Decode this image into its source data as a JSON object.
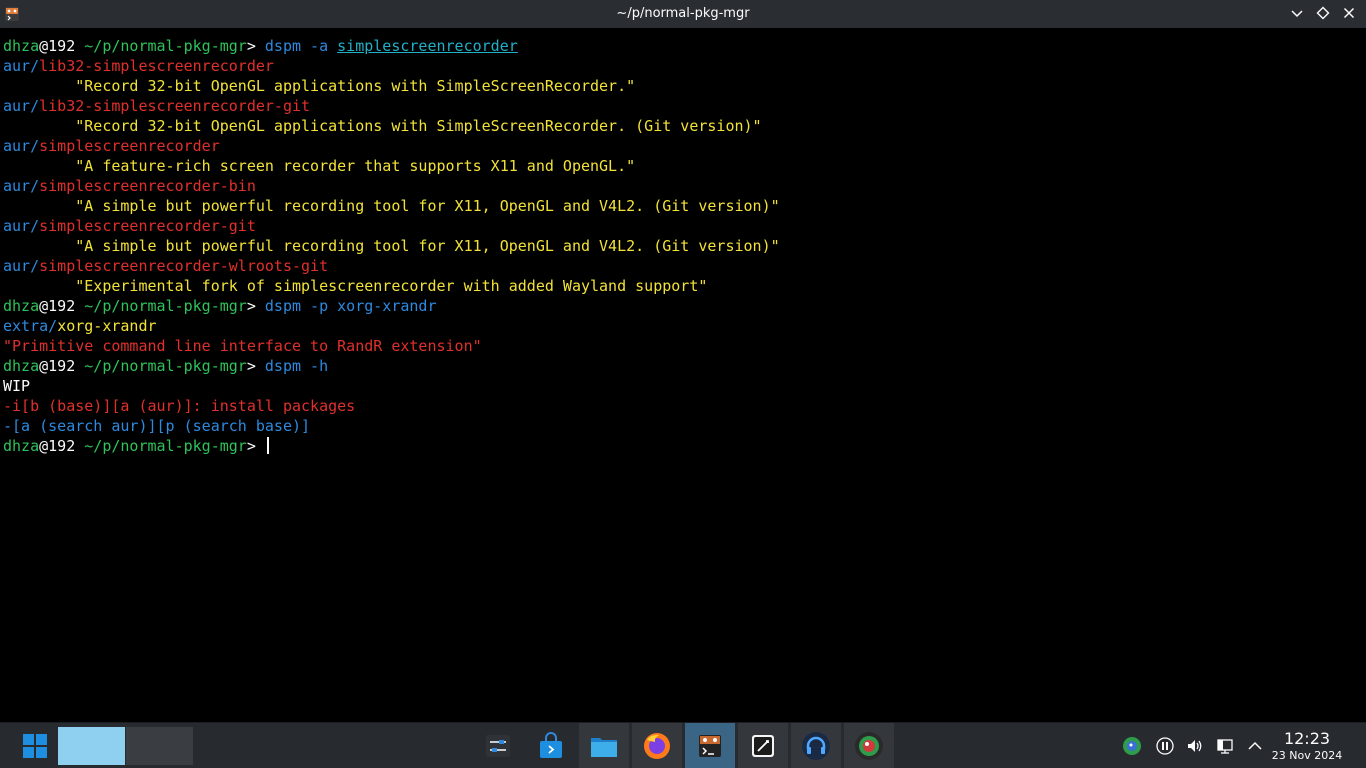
{
  "window": {
    "title": "~/p/normal-pkg-mgr",
    "controls": [
      "chevron-down-icon",
      "diamond-icon",
      "close-icon"
    ]
  },
  "terminal": {
    "lines": [
      [
        {
          "t": "dhza",
          "c": "green"
        },
        {
          "t": "@192 ",
          "c": "white"
        },
        {
          "t": "~/p/normal-pkg-mgr",
          "c": "green"
        },
        {
          "t": "> ",
          "c": "white"
        },
        {
          "t": "dspm",
          "c": "blue"
        },
        {
          "t": " -a ",
          "c": "blue"
        },
        {
          "t": "simplescreenrecorder",
          "c": "cyan",
          "u": true
        }
      ],
      [
        {
          "t": "aur/",
          "c": "blue"
        },
        {
          "t": "lib32-simplescreenrecorder",
          "c": "red"
        }
      ],
      [
        {
          "t": "        \"Record 32-bit OpenGL applications with SimpleScreenRecorder.\"",
          "c": "yellow"
        }
      ],
      [
        {
          "t": "aur/",
          "c": "blue"
        },
        {
          "t": "lib32-simplescreenrecorder-git",
          "c": "red"
        }
      ],
      [
        {
          "t": "        \"Record 32-bit OpenGL applications with SimpleScreenRecorder. (Git version)\"",
          "c": "yellow"
        }
      ],
      [
        {
          "t": "aur/",
          "c": "blue"
        },
        {
          "t": "simplescreenrecorder",
          "c": "red"
        }
      ],
      [
        {
          "t": "        \"A feature-rich screen recorder that supports X11 and OpenGL.\"",
          "c": "yellow"
        }
      ],
      [
        {
          "t": "aur/",
          "c": "blue"
        },
        {
          "t": "simplescreenrecorder-bin",
          "c": "red"
        }
      ],
      [
        {
          "t": "        \"A simple but powerful recording tool for X11, OpenGL and V4L2. (Git version)\"",
          "c": "yellow"
        }
      ],
      [
        {
          "t": "aur/",
          "c": "blue"
        },
        {
          "t": "simplescreenrecorder-git",
          "c": "red"
        }
      ],
      [
        {
          "t": "        \"A simple but powerful recording tool for X11, OpenGL and V4L2. (Git version)\"",
          "c": "yellow"
        }
      ],
      [
        {
          "t": "aur/",
          "c": "blue"
        },
        {
          "t": "simplescreenrecorder-wlroots-git",
          "c": "red"
        }
      ],
      [
        {
          "t": "        \"Experimental fork of simplescreenrecorder with added Wayland support\"",
          "c": "yellow"
        }
      ],
      [
        {
          "t": "dhza",
          "c": "green"
        },
        {
          "t": "@192 ",
          "c": "white"
        },
        {
          "t": "~/p/normal-pkg-mgr",
          "c": "green"
        },
        {
          "t": "> ",
          "c": "white"
        },
        {
          "t": "dspm",
          "c": "blue"
        },
        {
          "t": " -p xorg-xrandr",
          "c": "blue"
        }
      ],
      [
        {
          "t": "extra/",
          "c": "blue"
        },
        {
          "t": "xorg-xrandr",
          "c": "yellow"
        }
      ],
      [
        {
          "t": "\"Primitive command line interface to RandR extension\"",
          "c": "red"
        }
      ],
      [
        {
          "t": "dhza",
          "c": "green"
        },
        {
          "t": "@192 ",
          "c": "white"
        },
        {
          "t": "~/p/normal-pkg-mgr",
          "c": "green"
        },
        {
          "t": "> ",
          "c": "white"
        },
        {
          "t": "dspm",
          "c": "blue"
        },
        {
          "t": " -h",
          "c": "blue"
        }
      ],
      [
        {
          "t": "WIP",
          "c": "white"
        }
      ],
      [
        {
          "t": "-i[b (base)][a (aur)]: install packages",
          "c": "red"
        }
      ],
      [
        {
          "t": "-[a (search aur)][p (search base)]",
          "c": "blue"
        }
      ],
      [
        {
          "t": "dhza",
          "c": "green"
        },
        {
          "t": "@192 ",
          "c": "white"
        },
        {
          "t": "~/p/normal-pkg-mgr",
          "c": "green"
        },
        {
          "t": "> ",
          "c": "white"
        }
      ]
    ]
  },
  "taskbar": {
    "start_icon": "windows-start-icon",
    "tasks": [
      {
        "name": "system-settings-icon"
      },
      {
        "name": "software-store-icon"
      },
      {
        "name": "file-manager-icon"
      },
      {
        "name": "firefox-icon"
      },
      {
        "name": "terminal-icon"
      },
      {
        "name": "text-editor-icon"
      },
      {
        "name": "headphones-app-icon"
      },
      {
        "name": "lens-app-icon"
      }
    ],
    "tray": [
      "network-globe-icon",
      "media-pause-icon",
      "volume-icon",
      "display-icon",
      "chevron-up-icon"
    ],
    "clock": {
      "time": "12:23",
      "date": "23 Nov 2024"
    }
  },
  "colors": {
    "green": "#2ec25a",
    "white": "#fcfcfc",
    "blue": "#2d8ae0",
    "cyan": "#20b0c8",
    "red": "#e0302c",
    "yellow": "#f2e238",
    "taskbar_bg": "#272a2e",
    "active_task": "#3a6585"
  }
}
